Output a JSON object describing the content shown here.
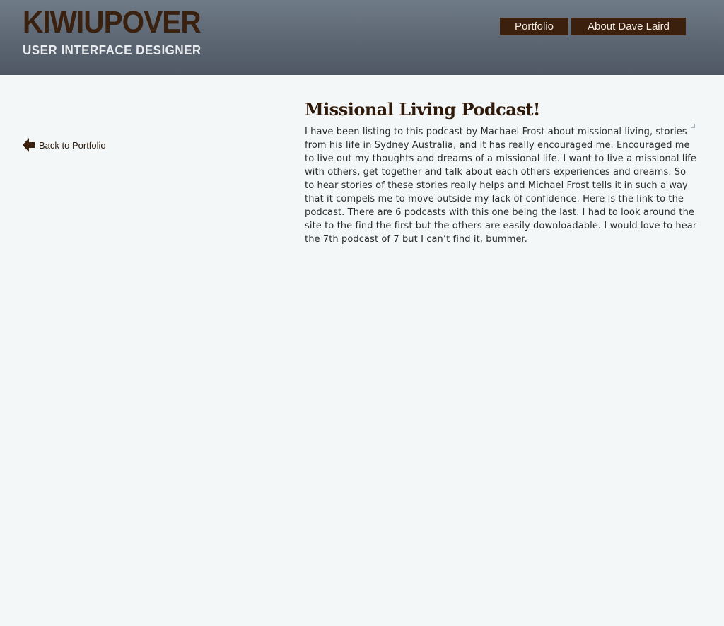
{
  "site": {
    "logo": "KIWIUPOVER",
    "tagline": "USER INTERFACE DESIGNER"
  },
  "nav": {
    "items": [
      {
        "label": "Portfolio"
      },
      {
        "label": "About Dave Laird"
      }
    ]
  },
  "back": {
    "label": "Back to Portfolio",
    "icon": "arrow-left-icon"
  },
  "post": {
    "title": "Missional Living Podcast!",
    "body": "I have been listing to this podcast by Machael Frost about missional living, stories from his life in Sydney Australia, and it has really encouraged me. Encouraged me to live out my thoughts and dreams of a missional life. I want to live a missional life with others, get together and talk about each others experiences and dreams. So to hear stories of these stories really helps and Michael Frost tells it in such a way that it compels me to move outside my lack of confidence. Here is the link to the podcast. There are 6 podcasts with this one being the last. I had to look around the site to the find the first but the others are easily downloadable. I would love to hear the 7th podcast of 7 but I can’t find it, bummer."
  },
  "colors": {
    "header": "#5c6673",
    "brand_brown": "#3b200d",
    "page_bg": "#f3f7f8"
  }
}
